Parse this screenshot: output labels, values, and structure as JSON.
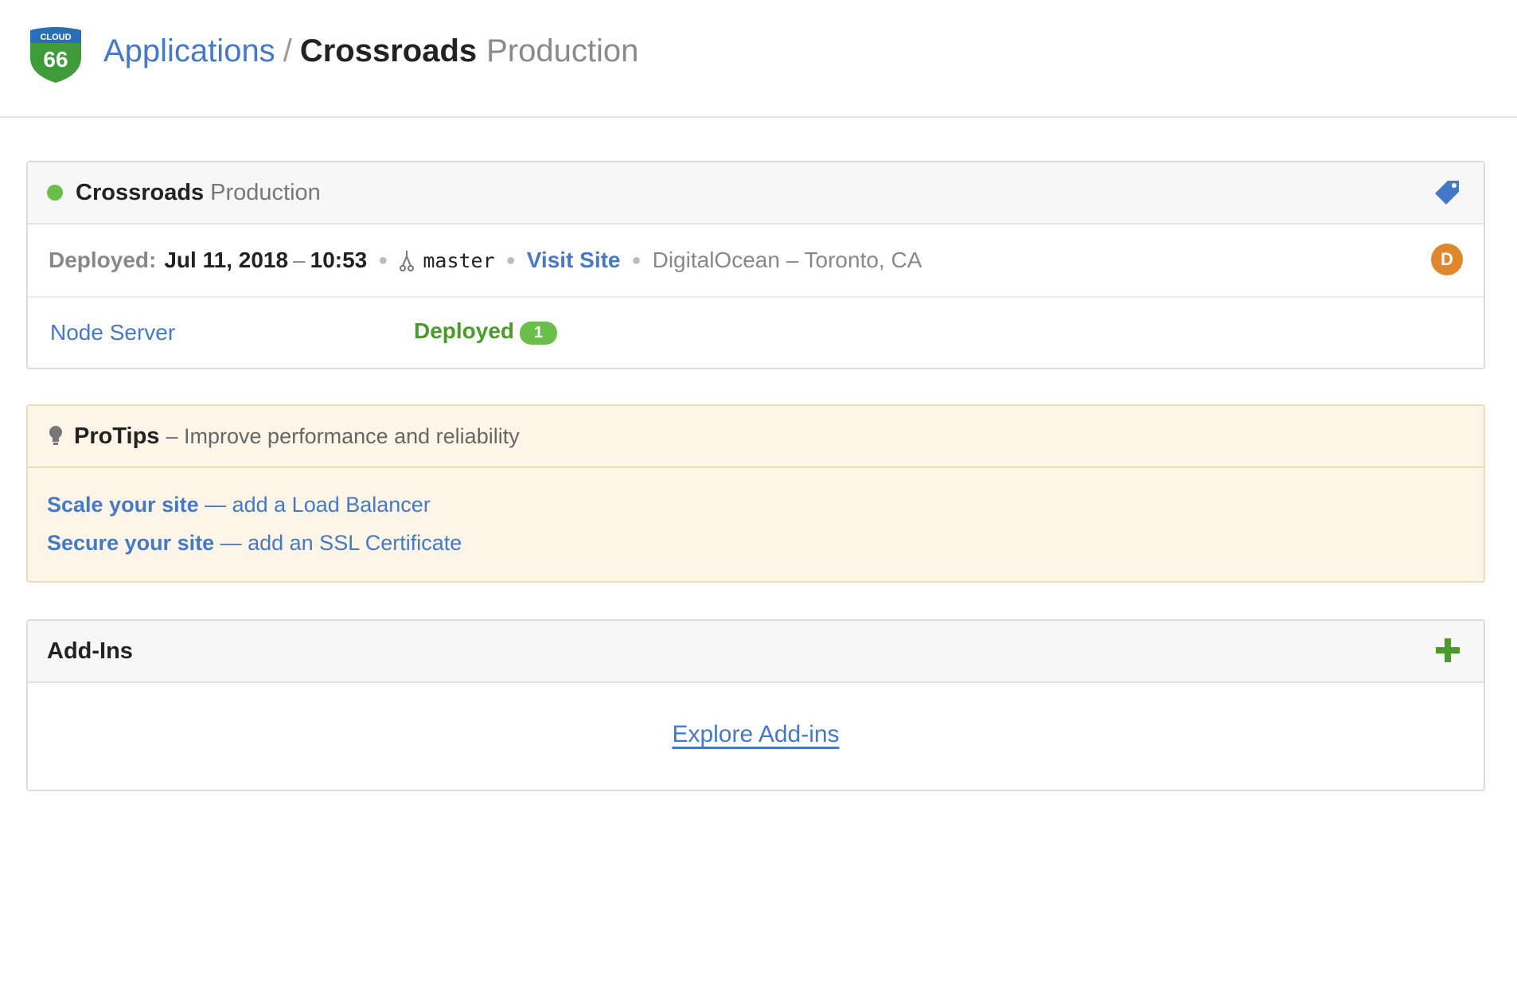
{
  "header": {
    "logo_text_top": "CLOUD",
    "logo_text_num": "66",
    "breadcrumb_root": "Applications",
    "separator": "/",
    "stack_name": "Crossroads",
    "environment": "Production"
  },
  "stack_panel": {
    "status_color": "#6abf4b",
    "name": "Crossroads",
    "environment": "Production",
    "deployed_label": "Deployed:",
    "deployed_date": "Jul 11, 2018",
    "deployed_sep": "–",
    "deployed_time": "10:53",
    "branch": "master",
    "visit_label": "Visit Site",
    "cloud": "DigitalOcean – Toronto, CA",
    "avatar_initial": "D",
    "server_name": "Node Server",
    "server_status": "Deployed",
    "server_count": "1"
  },
  "protips": {
    "title": "ProTips",
    "subtitle": "– Improve performance and reliability",
    "tips": [
      {
        "strong": "Scale your site",
        "rest": " — add a Load Balancer"
      },
      {
        "strong": "Secure your site",
        "rest": " — add an SSL Certificate"
      }
    ]
  },
  "addins": {
    "title": "Add-Ins",
    "explore_label": "Explore Add-ins"
  },
  "colors": {
    "link": "#4678c8",
    "success": "#4a9a2c",
    "avatar": "#e0862c"
  }
}
